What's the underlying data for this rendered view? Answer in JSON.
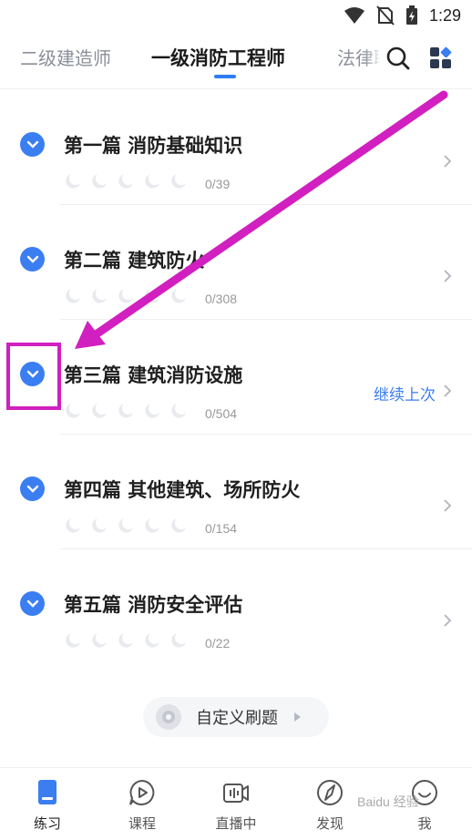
{
  "status_bar": {
    "time": "1:29"
  },
  "header": {
    "tabs": [
      {
        "label": "二级建造师"
      },
      {
        "label": "一级消防工程师"
      },
      {
        "label": "法律职"
      }
    ]
  },
  "chapters": [
    {
      "title": "第一篇 消防基础知识",
      "progress": "0/39",
      "resume": ""
    },
    {
      "title": "第二篇 建筑防火",
      "progress": "0/308",
      "resume": ""
    },
    {
      "title": "第三篇 建筑消防设施",
      "progress": "0/504",
      "resume": "继续上次"
    },
    {
      "title": "第四篇 其他建筑、场所防火",
      "progress": "0/154",
      "resume": ""
    },
    {
      "title": "第五篇 消防安全评估",
      "progress": "0/22",
      "resume": ""
    }
  ],
  "custom_practice": {
    "label": "自定义刷题"
  },
  "bottom_nav": [
    {
      "label": "练习"
    },
    {
      "label": "课程"
    },
    {
      "label": "直播中"
    },
    {
      "label": "发现"
    },
    {
      "label": "我"
    }
  ],
  "watermark": "Baidu 经验",
  "colors": {
    "accent": "#3a7ef2",
    "annotation": "#d11fc0"
  }
}
